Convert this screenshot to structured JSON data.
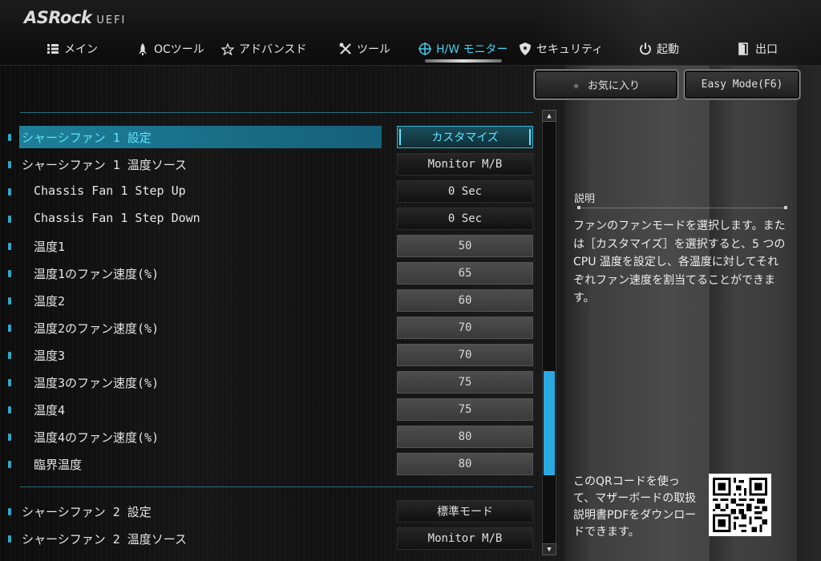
{
  "brand": {
    "logo": "ASRock",
    "suffix": "UEFI"
  },
  "nav": [
    {
      "label": "メイン",
      "icon": "list-icon"
    },
    {
      "label": "OCツール",
      "icon": "rocket-icon"
    },
    {
      "label": "アドバンスド",
      "icon": "star-icon"
    },
    {
      "label": "ツール",
      "icon": "tools-icon"
    },
    {
      "label": "H/W モニター",
      "icon": "crosshair-icon",
      "active": true
    },
    {
      "label": "セキュリティ",
      "icon": "shield-icon"
    },
    {
      "label": "起動",
      "icon": "power-icon"
    },
    {
      "label": "出口",
      "icon": "exit-door-icon"
    }
  ],
  "buttons": {
    "favorites": "お気に入り",
    "easy_mode": "Easy Mode(F6)"
  },
  "settings": [
    {
      "label": "シャーシファン 1 設定",
      "value": "カスタマイズ",
      "selected": true
    },
    {
      "label": "シャーシファン 1 温度ソース",
      "value": "Monitor M/B"
    },
    {
      "label": "Chassis Fan 1 Step Up",
      "value": "0 Sec"
    },
    {
      "label": "Chassis Fan 1 Step Down",
      "value": "0 Sec"
    },
    {
      "label": "温度1",
      "value": "50"
    },
    {
      "label": "温度1のファン速度(%)",
      "value": "65"
    },
    {
      "label": "温度2",
      "value": "60"
    },
    {
      "label": "温度2のファン速度(%)",
      "value": "70"
    },
    {
      "label": "温度3",
      "value": "70"
    },
    {
      "label": "温度3のファン速度(%)",
      "value": "75"
    },
    {
      "label": "温度4",
      "value": "75"
    },
    {
      "label": "温度4のファン速度(%)",
      "value": "80"
    },
    {
      "label": "臨界温度",
      "value": "80"
    },
    {
      "label": "シャーシファン 2 設定",
      "value": "標準モード"
    },
    {
      "label": "シャーシファン 2 温度ソース",
      "value": "Monitor M/B"
    }
  ],
  "description": {
    "title": "説明",
    "text": "ファンのファンモードを選択します。または［カスタマイズ］を選択すると、5 つの CPU 温度を設定し、各温度に対してそれぞれファン速度を割当てることができます。"
  },
  "qr": {
    "text": "このQRコードを使って、マザーボードの取扱説明書PDFをダウンロードできます。"
  },
  "colors": {
    "accent": "#3fd3f0",
    "selected_bg": "#1e7f99",
    "scroll_thumb": "#2aa9e0"
  }
}
